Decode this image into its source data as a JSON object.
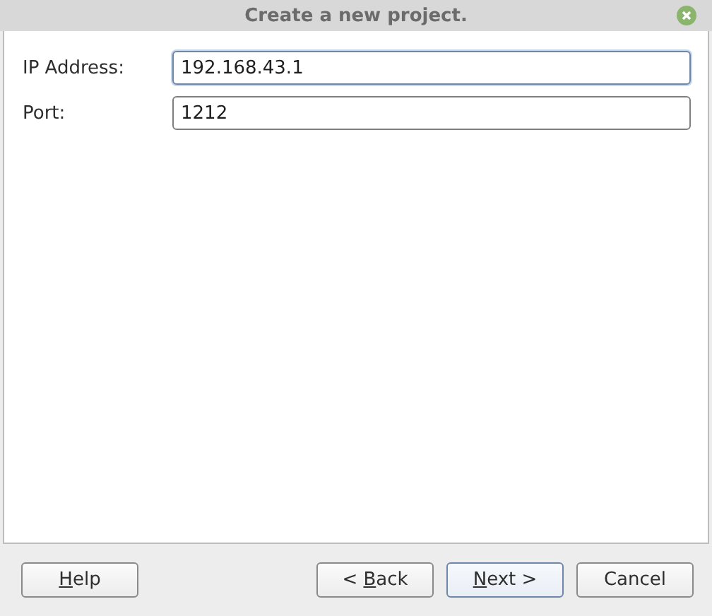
{
  "window": {
    "title": "Create a new project."
  },
  "fields": [
    {
      "label": "IP Address:",
      "value": "192.168.43.1",
      "focused": true
    },
    {
      "label": "Port:",
      "value": "1212",
      "focused": false
    }
  ],
  "left_buttons": [
    {
      "label": [
        {
          "text": "H",
          "underlined": true
        },
        {
          "text": "elp",
          "underlined": false
        }
      ],
      "default": false
    }
  ],
  "right_buttons": [
    {
      "label": [
        {
          "text": "< ",
          "underlined": false
        },
        {
          "text": "B",
          "underlined": true
        },
        {
          "text": "ack",
          "underlined": false
        }
      ],
      "default": false
    },
    {
      "label": [
        {
          "text": "N",
          "underlined": true
        },
        {
          "text": "ext >",
          "underlined": false
        }
      ],
      "default": true
    },
    {
      "label": [
        {
          "text": "Cancel",
          "underlined": false
        }
      ],
      "default": false
    }
  ]
}
